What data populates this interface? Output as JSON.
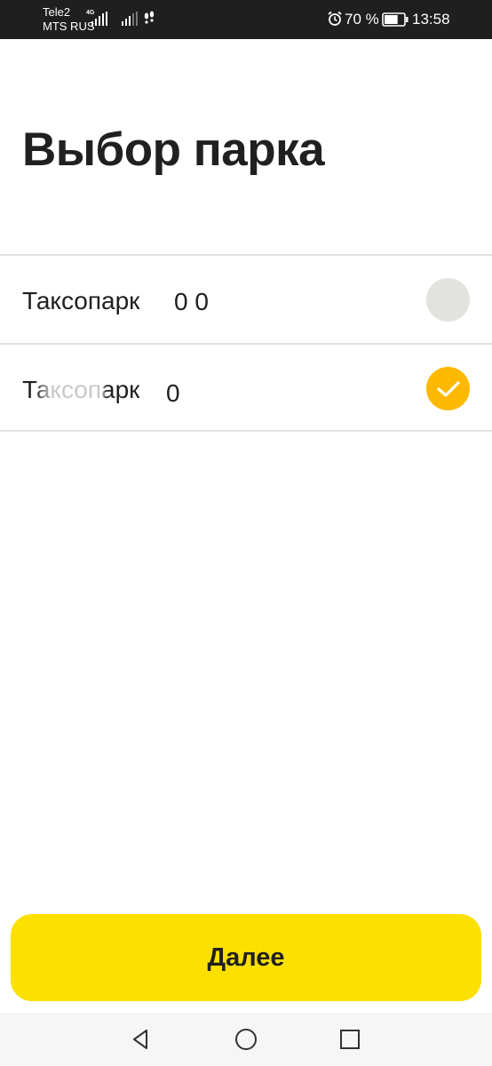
{
  "status_bar": {
    "carrier_1": "Tele2",
    "carrier_2": "MTS RUS",
    "network_type": "4G",
    "battery_percent": "70 %",
    "battery_level": 0.7,
    "time": "13:58",
    "icons": [
      "signal-icon",
      "signal-icon",
      "steps-icon",
      "alarm-icon",
      "battery-icon"
    ]
  },
  "title": "Выбор парка",
  "parks": [
    {
      "label": "Таксопарк",
      "number": "0 0",
      "selected": false
    },
    {
      "label": "Таксопарк",
      "number": "0",
      "selected": true
    }
  ],
  "next_button": {
    "label": "Далее"
  },
  "colors": {
    "accent_yellow": "#fce000",
    "check_orange": "#fcb900",
    "radio_unselected": "#e2e2df",
    "text": "#21201f",
    "divider": "#e2e2e0"
  },
  "nav_bar": {
    "icons": [
      "back-icon",
      "home-icon",
      "recent-apps-icon"
    ]
  }
}
